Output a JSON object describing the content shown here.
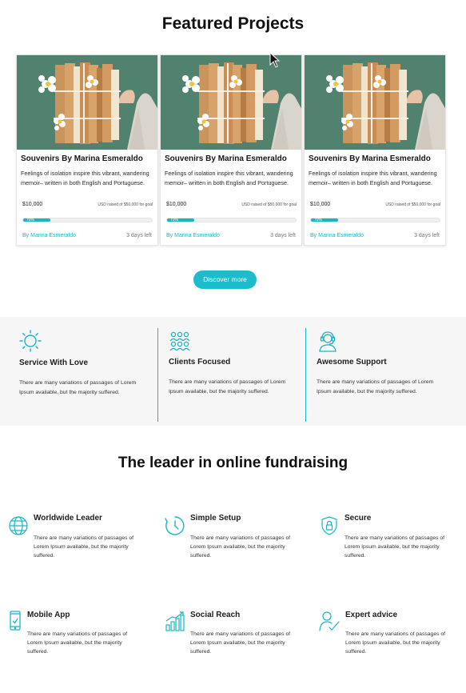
{
  "featured": {
    "title": "Featured Projects",
    "cards": [
      {
        "title": "Souvenirs By Marina Esmeraldo",
        "description": "Feelings of isolation inspire this vibrant, wandering memoir– written in both English and Portuguese.",
        "amount": "$10,000",
        "goal_text": "USD raised of $50,000 for goal",
        "progress_label": "70%",
        "progress": 0.21,
        "author": "By Marina Esmeraldo",
        "days_left": "3 days left"
      },
      {
        "title": "Souvenirs By Marina Esmeraldo",
        "description": "Feelings of isolation inspire this vibrant, wandering memoir– written in both English and Portuguese.",
        "amount": "$10,000",
        "goal_text": "USD raised of $50,000 for goal",
        "progress_label": "70%",
        "progress": 0.21,
        "author": "By Marina Esmeraldo",
        "days_left": "3 days left"
      },
      {
        "title": "Souvenirs By Marina Esmeraldo",
        "description": "Feelings of isolation inspire this vibrant, wandering memoir– written in both English and Portuguese.",
        "amount": "$10,000",
        "goal_text": "USD raised of $50,000 for goal",
        "progress_label": "70%",
        "progress": 0.21,
        "author": "By Marina Esmeraldo",
        "days_left": "3 days left"
      }
    ],
    "discover_label": "Discover more"
  },
  "services": [
    {
      "icon": "sun-icon",
      "title": "Service With Love",
      "description": "There are many variations of passages of Lorem Ipsum available, but the majority suffered."
    },
    {
      "icon": "group-icon",
      "title": "Clients Focused",
      "description": "There are many variations of passages of Lorem Ipsum available, but the majority suffered."
    },
    {
      "icon": "headset-support-icon",
      "title": "Awesome Support",
      "description": "There are many variations of passages of Lorem Ipsum available, but the majority suffered."
    }
  ],
  "leader": {
    "title": "The leader in online fundraising",
    "features": [
      {
        "icon": "globe-icon",
        "title": "Worldwide Leader",
        "description": "There are many variations of passages of Lorem Ipsum available, but the majority suffered."
      },
      {
        "icon": "clock-icon",
        "title": "Simple Setup",
        "description": "There are many variations of passages of Lorem Ipsum available, but the majority suffered."
      },
      {
        "icon": "shield-lock-icon",
        "title": "Secure",
        "description": "There are many variations of passages of Lorem Ipsum available, but the majority suffered."
      },
      {
        "icon": "mobile-phone-icon",
        "title": "Mobile App",
        "description": "There are many variations of passages of Lorem Ipsum available, but the majority suffered."
      },
      {
        "icon": "bar-chart-icon",
        "title": "Social Reach",
        "description": "There are many variations of passages of Lorem Ipsum available, but the majority suffered."
      },
      {
        "icon": "user-check-icon",
        "title": "Expert advice",
        "description": "There are many variations of passages of Lorem Ipsum available, but the majority suffered."
      }
    ]
  },
  "colors": {
    "accent": "#1cb5c4",
    "button": "#1cbccc",
    "card_image_bg": "#4e7e6c",
    "services_bg": "#f6f6f6"
  }
}
